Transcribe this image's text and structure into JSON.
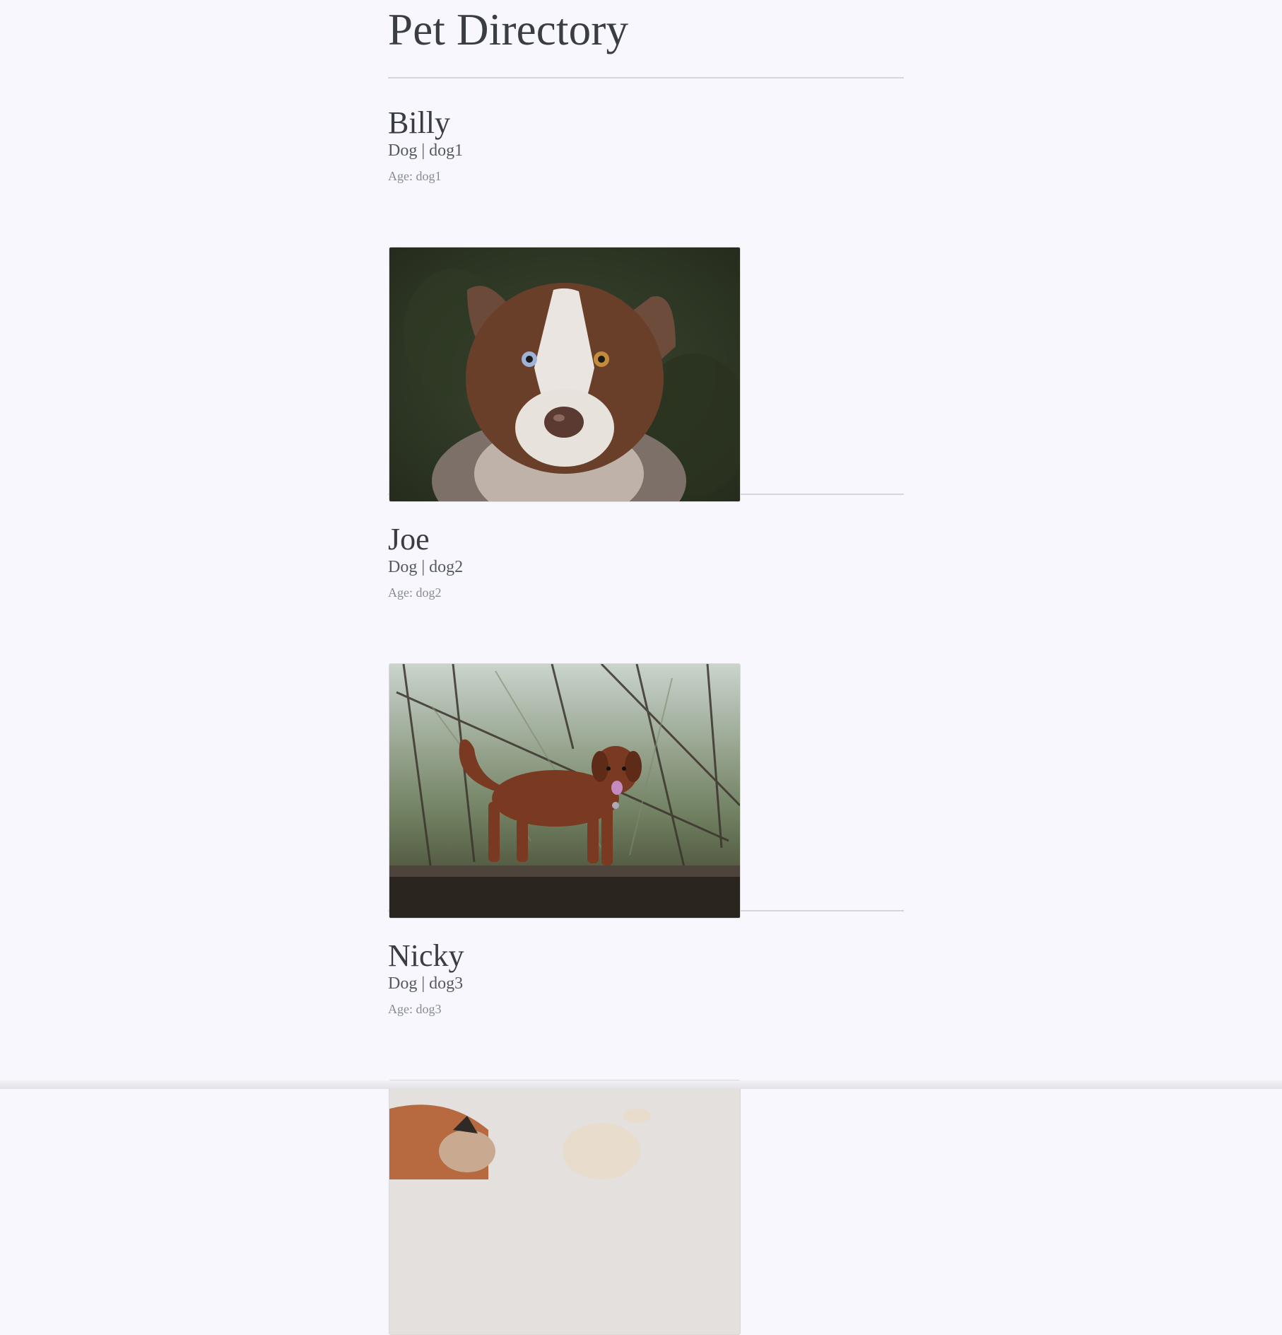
{
  "page": {
    "title": "Pet Directory"
  },
  "pets": [
    {
      "name": "Billy",
      "meta": "Dog | dog1",
      "age": "Age: dog1",
      "photo_icon": "dog-portrait-photo"
    },
    {
      "name": "Joe",
      "meta": "Dog | dog2",
      "age": "Age: dog2",
      "photo_icon": "dog-on-log-photo"
    },
    {
      "name": "Nicky",
      "meta": "Dog | dog3",
      "age": "Age: dog3",
      "photo_icon": "pugs-lying-photo"
    }
  ],
  "colors": {
    "background": "#f8f7fd",
    "text": "#3a3d42",
    "rule": "#d6d7db"
  }
}
